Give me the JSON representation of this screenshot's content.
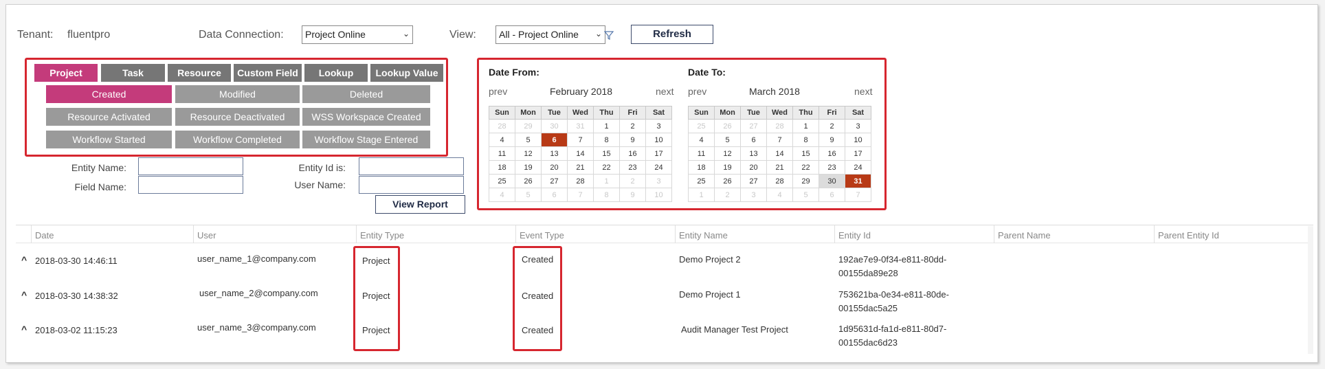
{
  "header": {
    "tenant_label": "Tenant:",
    "tenant_value": "fluentpro",
    "data_connection_label": "Data Connection:",
    "data_connection_value": "Project Online",
    "view_label": "View:",
    "view_value": "All - Project Online",
    "refresh_label": "Refresh"
  },
  "entity_tabs": [
    {
      "label": "Project",
      "active": true
    },
    {
      "label": "Task",
      "active": false
    },
    {
      "label": "Resource",
      "active": false
    },
    {
      "label": "Custom Field",
      "active": false
    },
    {
      "label": "Lookup",
      "active": false
    },
    {
      "label": "Lookup Value",
      "active": false
    }
  ],
  "event_buttons": [
    {
      "label": "Created",
      "active": true
    },
    {
      "label": "Modified",
      "active": false
    },
    {
      "label": "Deleted",
      "active": false
    },
    {
      "label": "Resource Activated",
      "active": false
    },
    {
      "label": "Resource Deactivated",
      "active": false
    },
    {
      "label": "WSS Workspace Created",
      "active": false
    },
    {
      "label": "Workflow Started",
      "active": false
    },
    {
      "label": "Workflow Completed",
      "active": false
    },
    {
      "label": "Workflow Stage Entered",
      "active": false
    }
  ],
  "filters": {
    "entity_name_label": "Entity Name:",
    "field_name_label": "Field Name:",
    "entity_id_label": "Entity Id is:",
    "user_name_label": "User  Name:",
    "view_report_label": "View Report"
  },
  "calendar_from": {
    "title": "Date From:",
    "prev": "prev",
    "next": "next",
    "month": "February 2018",
    "weekdays": [
      "Sun",
      "Mon",
      "Tue",
      "Wed",
      "Thu",
      "Fri",
      "Sat"
    ],
    "weeks": [
      [
        {
          "d": "28",
          "o": true
        },
        {
          "d": "29",
          "o": true
        },
        {
          "d": "30",
          "o": true
        },
        {
          "d": "31",
          "o": true
        },
        {
          "d": "1"
        },
        {
          "d": "2"
        },
        {
          "d": "3"
        }
      ],
      [
        {
          "d": "4"
        },
        {
          "d": "5"
        },
        {
          "d": "6",
          "s": true
        },
        {
          "d": "7"
        },
        {
          "d": "8"
        },
        {
          "d": "9"
        },
        {
          "d": "10"
        }
      ],
      [
        {
          "d": "11"
        },
        {
          "d": "12"
        },
        {
          "d": "13"
        },
        {
          "d": "14"
        },
        {
          "d": "15"
        },
        {
          "d": "16"
        },
        {
          "d": "17"
        }
      ],
      [
        {
          "d": "18"
        },
        {
          "d": "19"
        },
        {
          "d": "20"
        },
        {
          "d": "21"
        },
        {
          "d": "22"
        },
        {
          "d": "23"
        },
        {
          "d": "24"
        }
      ],
      [
        {
          "d": "25"
        },
        {
          "d": "26"
        },
        {
          "d": "27"
        },
        {
          "d": "28"
        },
        {
          "d": "1",
          "o": true
        },
        {
          "d": "2",
          "o": true
        },
        {
          "d": "3",
          "o": true
        }
      ],
      [
        {
          "d": "4",
          "o": true
        },
        {
          "d": "5",
          "o": true
        },
        {
          "d": "6",
          "o": true
        },
        {
          "d": "7",
          "o": true
        },
        {
          "d": "8",
          "o": true
        },
        {
          "d": "9",
          "o": true
        },
        {
          "d": "10",
          "o": true
        }
      ]
    ]
  },
  "calendar_to": {
    "title": "Date To:",
    "prev": "prev",
    "next": "next",
    "month": "March 2018",
    "weekdays": [
      "Sun",
      "Mon",
      "Tue",
      "Wed",
      "Thu",
      "Fri",
      "Sat"
    ],
    "weeks": [
      [
        {
          "d": "25",
          "o": true
        },
        {
          "d": "26",
          "o": true
        },
        {
          "d": "27",
          "o": true
        },
        {
          "d": "28",
          "o": true
        },
        {
          "d": "1"
        },
        {
          "d": "2"
        },
        {
          "d": "3"
        }
      ],
      [
        {
          "d": "4"
        },
        {
          "d": "5"
        },
        {
          "d": "6"
        },
        {
          "d": "7"
        },
        {
          "d": "8"
        },
        {
          "d": "9"
        },
        {
          "d": "10"
        }
      ],
      [
        {
          "d": "11"
        },
        {
          "d": "12"
        },
        {
          "d": "13"
        },
        {
          "d": "14"
        },
        {
          "d": "15"
        },
        {
          "d": "16"
        },
        {
          "d": "17"
        }
      ],
      [
        {
          "d": "18"
        },
        {
          "d": "19"
        },
        {
          "d": "20"
        },
        {
          "d": "21"
        },
        {
          "d": "22"
        },
        {
          "d": "23"
        },
        {
          "d": "24"
        }
      ],
      [
        {
          "d": "25"
        },
        {
          "d": "26"
        },
        {
          "d": "27"
        },
        {
          "d": "28"
        },
        {
          "d": "29"
        },
        {
          "d": "30",
          "r": true
        },
        {
          "d": "31",
          "s": true
        }
      ],
      [
        {
          "d": "1",
          "o": true
        },
        {
          "d": "2",
          "o": true
        },
        {
          "d": "3",
          "o": true
        },
        {
          "d": "4",
          "o": true
        },
        {
          "d": "5",
          "o": true
        },
        {
          "d": "6",
          "o": true
        },
        {
          "d": "7",
          "o": true
        }
      ]
    ]
  },
  "table": {
    "columns": [
      "Date",
      "User",
      "Entity Type",
      "Event Type",
      "Entity Name",
      "Entity Id",
      "Parent Name",
      "Parent Entity Id"
    ],
    "rows": [
      {
        "date": "2018-03-30 14:46:11",
        "user": "user_name_1@company.com",
        "entity_type": "Project",
        "event_type": "Created",
        "entity_name": "Demo Project 2",
        "entity_id_1": "192ae7e9-0f34-e811-80dd-",
        "entity_id_2": "00155da89e28",
        "parent_name": "",
        "parent_entity_id": ""
      },
      {
        "date": "2018-03-30 14:38:32",
        "user": "user_name_2@company.com",
        "entity_type": "Project",
        "event_type": "Created",
        "entity_name": "Demo Project 1",
        "entity_id_1": "753621ba-0e34-e811-80de-",
        "entity_id_2": "00155dac5a25",
        "parent_name": "",
        "parent_entity_id": ""
      },
      {
        "date": "2018-03-02 11:15:23",
        "user": "user_name_3@company.com",
        "entity_type": "Project",
        "event_type": "Created",
        "entity_name": "Audit Manager Test Project",
        "entity_id_1": "1d95631d-fa1d-e811-80d7-",
        "entity_id_2": "00155dac6d23",
        "parent_name": "",
        "parent_entity_id": ""
      }
    ]
  },
  "colors": {
    "accent": "#c43b7b",
    "highlight": "#d6262f",
    "selected_day": "#b83a16"
  }
}
